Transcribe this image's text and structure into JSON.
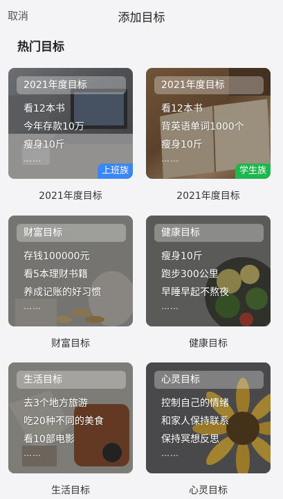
{
  "header": {
    "cancel": "取消",
    "title": "添加目标"
  },
  "section_title": "热门目标",
  "cards": [
    {
      "chip": "2021年度目标",
      "lines": [
        "看12本书",
        "今年存款10万",
        "瘦身10斤"
      ],
      "dots": "……",
      "badge": "上班族",
      "caption": "2021年度目标"
    },
    {
      "chip": "2021年度目标",
      "lines": [
        "看12本书",
        "背英语单词1000个",
        "瘦身10斤"
      ],
      "dots": "……",
      "badge": "学生族",
      "caption": "2021年度目标"
    },
    {
      "chip": "财富目标",
      "lines": [
        "存钱100000元",
        "看5本理财书籍",
        "养成记账的好习惯"
      ],
      "dots": "……",
      "caption": "财富目标"
    },
    {
      "chip": "健康目标",
      "lines": [
        "瘦身10斤",
        "跑步300公里",
        "早睡早起不熬夜"
      ],
      "dots": "……",
      "caption": "健康目标"
    },
    {
      "chip": "生活目标",
      "lines": [
        "去3个地方旅游",
        "吃20种不同的美食",
        "看10部电影"
      ],
      "dots": "……",
      "caption": "生活目标"
    },
    {
      "chip": "心灵目标",
      "lines": [
        "控制自己的情绪",
        "和家人保持联系",
        "保持冥想反思"
      ],
      "dots": "……",
      "caption": "心灵目标"
    }
  ],
  "colors": {
    "badge_blue": "#3b86f5",
    "badge_green": "#1eb74e",
    "background": "#f4f4f6"
  }
}
